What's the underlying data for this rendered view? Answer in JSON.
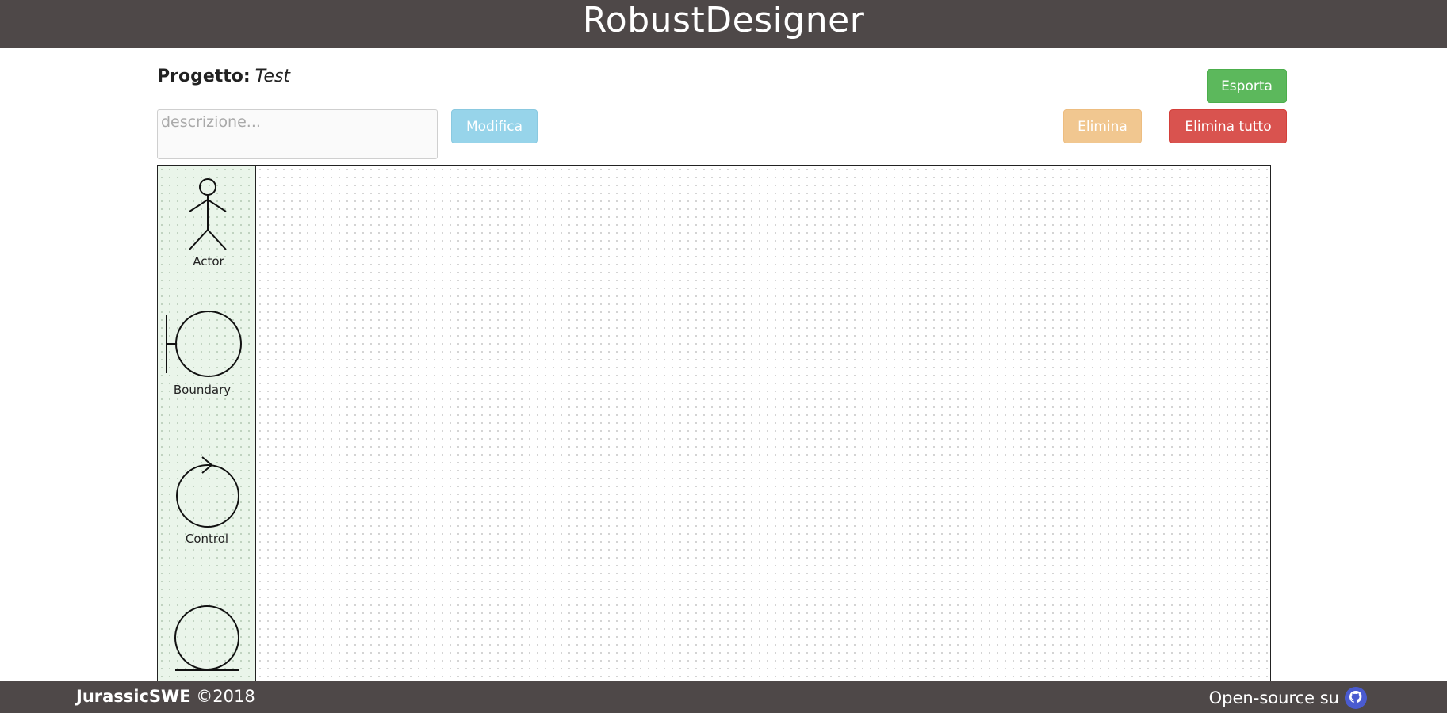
{
  "header": {
    "title": "RobustDesigner"
  },
  "project": {
    "label": "Progetto:",
    "name": "Test",
    "description_value": "",
    "description_placeholder": "descrizione..."
  },
  "buttons": {
    "modifica": "Modifica",
    "esporta": "Esporta",
    "elimina": "Elimina",
    "elimina_tutto": "Elimina tutto"
  },
  "palette": {
    "items": [
      {
        "label": "Actor",
        "icon": "actor-icon"
      },
      {
        "label": "Boundary",
        "icon": "boundary-icon"
      },
      {
        "label": "Control",
        "icon": "control-icon"
      },
      {
        "label": "",
        "icon": "entity-icon"
      }
    ]
  },
  "footer": {
    "brand": "JurassicSWE",
    "copyright": "©2018",
    "open_source": "Open-source su",
    "github_icon": "github-icon"
  },
  "colors": {
    "header_bg": "#4e4848",
    "esporta": "#5cb85c",
    "modifica": "#97d4ea",
    "elimina": "#f1c790",
    "elimina_tutto": "#d9534f",
    "palette_bg": "#eaf5ea",
    "github": "#4a5bd0"
  }
}
